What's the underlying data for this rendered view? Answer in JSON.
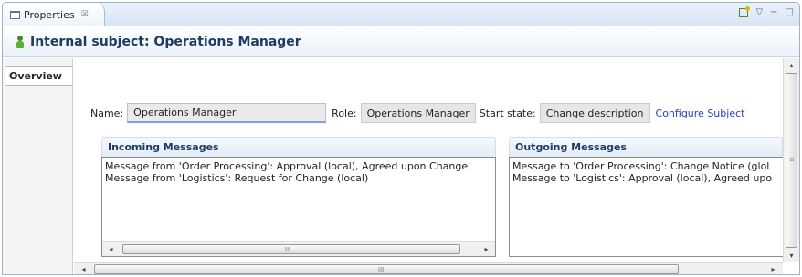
{
  "view": {
    "tab_title": "Properties",
    "tab_close_glyph": "☒",
    "tab_icon": "window-icon",
    "actions": [
      {
        "name": "pin-icon",
        "glyph": ""
      },
      {
        "name": "view-menu-icon",
        "glyph": "▽"
      },
      {
        "name": "minimize-icon",
        "glyph": "−"
      },
      {
        "name": "maximize-icon",
        "glyph": "□"
      }
    ]
  },
  "header": {
    "icon": "person-icon",
    "title": "Internal subject: Operations Manager"
  },
  "sidebar": {
    "tabs": [
      {
        "label": "Overview",
        "selected": true
      }
    ]
  },
  "form": {
    "name_label": "Name:",
    "name_value": "Operations Manager",
    "role_label": "Role:",
    "role_value": "Operations Manager",
    "start_state_label": "Start state:",
    "start_state_value": "Change description",
    "configure_link": "Configure Subject"
  },
  "incoming": {
    "title": "Incoming Messages",
    "items": [
      "Message from 'Order Processing': Approval (local), Agreed upon Change",
      "Message from 'Logistics': Request for Change (local)"
    ]
  },
  "outgoing": {
    "title": "Outgoing Messages",
    "items": [
      "Message to 'Order Processing': Change Notice (glol",
      "Message to 'Logistics': Approval (local), Agreed upo"
    ]
  },
  "scroll": {
    "left_arrow": "◂",
    "right_arrow": "▸",
    "up_arrow": "▴",
    "down_arrow": "▾",
    "grip": "III"
  },
  "colors": {
    "header_title": "#1f3a64",
    "link": "#2a3fb0",
    "border": "#9fb3c8"
  }
}
